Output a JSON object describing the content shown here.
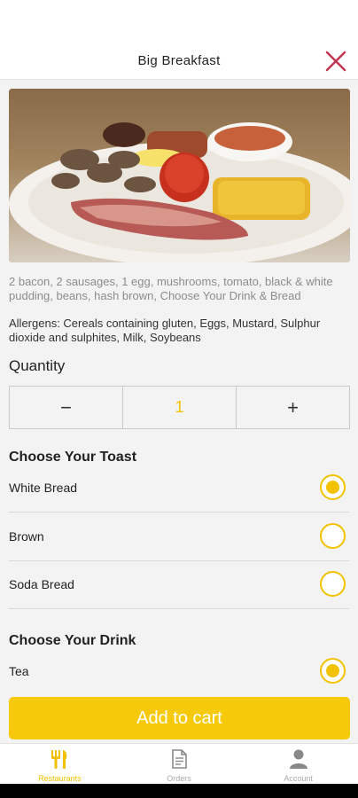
{
  "header": {
    "title": "Big Breakfast",
    "close_icon": "close-icon"
  },
  "item": {
    "image_alt": "Big Breakfast plate",
    "description": "2 bacon, 2 sausages, 1 egg, mushrooms, tomato, black & white pudding, beans, hash brown, Choose Your Drink & Bread",
    "allergens": "Allergens: Cereals containing gluten, Eggs, Mustard, Sulphur dioxide and sulphites, Milk, Soybeans"
  },
  "quantity": {
    "title": "Quantity",
    "minus": "−",
    "value": "1",
    "plus": "+"
  },
  "toast": {
    "title": "Choose Your Toast",
    "options": [
      {
        "label": "White Bread",
        "selected": true
      },
      {
        "label": "Brown",
        "selected": false
      },
      {
        "label": "Soda Bread",
        "selected": false
      }
    ]
  },
  "drink": {
    "title": "Choose Your Drink",
    "options": [
      {
        "label": "Tea",
        "selected": true
      }
    ]
  },
  "cart": {
    "label": "Add to cart"
  },
  "tabs": [
    {
      "label": "Restaurants",
      "icon": "fork-knife-icon",
      "active": true
    },
    {
      "label": "Orders",
      "icon": "document-icon",
      "active": false
    },
    {
      "label": "Account",
      "icon": "person-icon",
      "active": false
    }
  ],
  "colors": {
    "accent": "#f6ca0b",
    "close": "#c0354f",
    "background": "#f3f3f3"
  }
}
